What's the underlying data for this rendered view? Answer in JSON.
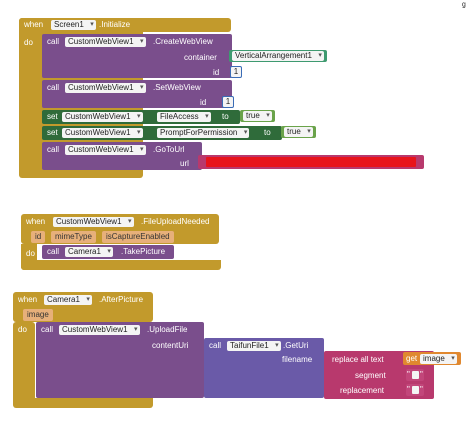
{
  "block1": {
    "when": "when",
    "component": "Screen1",
    "event": ".Initialize",
    "do": "do",
    "call1": {
      "call": "call",
      "component": "CustomWebView1",
      "method": ".CreateWebView",
      "arg_container": "container",
      "container_value": "VerticalArrangement1",
      "arg_id": "id",
      "id_value": "1"
    },
    "call2": {
      "call": "call",
      "component": "CustomWebView1",
      "method": ".SetWebView",
      "arg_id": "id",
      "id_value": "1"
    },
    "set1": {
      "set": "set",
      "component": "CustomWebView1",
      "property": "FileAccess",
      "to": "to",
      "value": "true"
    },
    "set2": {
      "set": "set",
      "component": "CustomWebView1",
      "property": "PromptForPermission",
      "to": "to",
      "value": "true"
    },
    "call3": {
      "call": "call",
      "component": "CustomWebView1",
      "method": ".GoToUrl",
      "arg_url": "url"
    }
  },
  "block2": {
    "when": "when",
    "component": "CustomWebView1",
    "event": ".FileUploadNeeded",
    "params": [
      "id",
      "mimeType",
      "isCaptureEnabled"
    ],
    "do": "do",
    "call": {
      "call": "call",
      "component": "Camera1",
      "method": ".TakePicture"
    }
  },
  "block3": {
    "when": "when",
    "component": "Camera1",
    "event": ".AfterPicture",
    "param": "image",
    "do": "do",
    "call": {
      "call": "call",
      "component": "CustomWebView1",
      "method": ".UploadFile",
      "arg_contentUri": "contentUri"
    },
    "inner": {
      "call": "call",
      "component": "TaifunFile1",
      "method": ".GetUri",
      "arg_filename": "filename"
    },
    "replace": {
      "label": "replace all text",
      "segment": "segment",
      "replacement": "replacement"
    },
    "get": {
      "label": "get",
      "var": "image"
    }
  },
  "colors": {
    "event": "#c29a2c",
    "call": "#7a4e8c",
    "set": "#2f6b3a",
    "text": "#b8396d",
    "component": "#3e9a70",
    "number": "#3a6cb6",
    "logic": "#6aa34a",
    "redacted": "#e8141a"
  }
}
